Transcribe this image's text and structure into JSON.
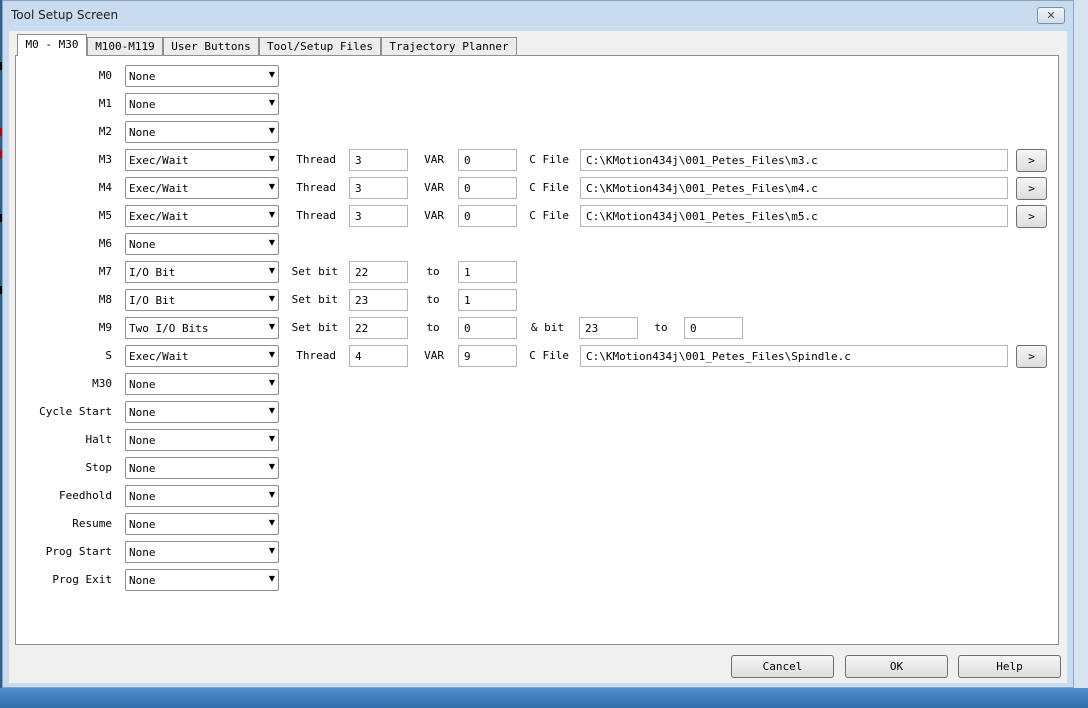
{
  "window": {
    "title": "Tool Setup Screen",
    "close_glyph": "✕"
  },
  "tabs": [
    {
      "label": "M0 - M30",
      "active": true
    },
    {
      "label": "M100-M119",
      "active": false
    },
    {
      "label": "User Buttons",
      "active": false
    },
    {
      "label": "Tool/Setup Files",
      "active": false
    },
    {
      "label": "Trajectory Planner",
      "active": false
    }
  ],
  "rows": [
    {
      "label": "M0",
      "action": "None"
    },
    {
      "label": "M1",
      "action": "None"
    },
    {
      "label": "M2",
      "action": "None"
    },
    {
      "label": "M3",
      "action": "Exec/Wait",
      "kind": "exec",
      "p1_label": "Thread",
      "p1_value": "3",
      "p2_label": "VAR",
      "p2_value": "0",
      "p3_label": "C File",
      "p3_value": "C:\\KMotion434j\\001_Petes_Files\\m3.c",
      "browse_label": ">"
    },
    {
      "label": "M4",
      "action": "Exec/Wait",
      "kind": "exec",
      "p1_label": "Thread",
      "p1_value": "3",
      "p2_label": "VAR",
      "p2_value": "0",
      "p3_label": "C File",
      "p3_value": "C:\\KMotion434j\\001_Petes_Files\\m4.c",
      "browse_label": ">"
    },
    {
      "label": "M5",
      "action": "Exec/Wait",
      "kind": "exec",
      "p1_label": "Thread",
      "p1_value": "3",
      "p2_label": "VAR",
      "p2_value": "0",
      "p3_label": "C File",
      "p3_value": "C:\\KMotion434j\\001_Petes_Files\\m5.c",
      "browse_label": ">"
    },
    {
      "label": "M6",
      "action": "None"
    },
    {
      "label": "M7",
      "action": "I/O Bit",
      "kind": "iobit",
      "p1_label": "Set bit",
      "p1_value": "22",
      "p2_label": "to",
      "p2_value": "1"
    },
    {
      "label": "M8",
      "action": "I/O Bit",
      "kind": "iobit",
      "p1_label": "Set bit",
      "p1_value": "23",
      "p2_label": "to",
      "p2_value": "1"
    },
    {
      "label": "M9",
      "action": "Two I/O Bits",
      "kind": "twobits",
      "p1_label": "Set bit",
      "p1_value": "22",
      "p2_label": "to",
      "p2_value": "0",
      "p3_label": "& bit",
      "p3_value": "23",
      "p4_label": "to",
      "p4_value": "0"
    },
    {
      "label": "S",
      "action": "Exec/Wait",
      "kind": "exec",
      "p1_label": "Thread",
      "p1_value": "4",
      "p2_label": "VAR",
      "p2_value": "9",
      "p3_label": "C File",
      "p3_value": "C:\\KMotion434j\\001_Petes_Files\\Spindle.c",
      "browse_label": ">"
    },
    {
      "label": "M30",
      "action": "None"
    },
    {
      "label": "Cycle Start",
      "action": "None"
    },
    {
      "label": "Halt",
      "action": "None"
    },
    {
      "label": "Stop",
      "action": "None"
    },
    {
      "label": "Feedhold",
      "action": "None"
    },
    {
      "label": "Resume",
      "action": "None"
    },
    {
      "label": "Prog Start",
      "action": "None"
    },
    {
      "label": "Prog Exit",
      "action": "None"
    }
  ],
  "buttons": {
    "cancel": "Cancel",
    "ok": "OK",
    "help": "Help"
  },
  "colors": {
    "window_frame": "#c8dbef",
    "desktop": "#3a6ea5",
    "client": "#f0f0f0"
  }
}
